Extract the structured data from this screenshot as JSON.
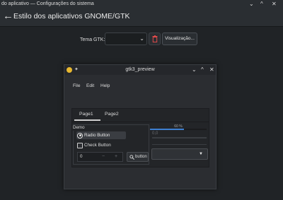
{
  "window": {
    "title": "do aplicativo — Configurações do sistema",
    "controls": {
      "minimize": "⌄",
      "maximize": "^",
      "close": "✕"
    }
  },
  "header": {
    "back_icon": "←",
    "title": "Estilo dos aplicativos GNOME/GTK"
  },
  "gtk_theme": {
    "label": "Tema GTK:",
    "value": "",
    "chevron": "⌄",
    "delete_icon": "trash-icon",
    "delete_color": "#e04a4a",
    "preview_button": "Visualização..."
  },
  "preview_window": {
    "title": "gtk3_preview",
    "controls": {
      "minimize": "⌄",
      "maximize": "^",
      "close": "✕"
    },
    "pin_icon": "✦",
    "menu": [
      "File",
      "Edit",
      "Help"
    ],
    "tabs": [
      "Page1",
      "Page2"
    ],
    "active_tab": 0,
    "demo": {
      "frame_label": "Demo",
      "radio_label": "Radio Button",
      "radio_checked": true,
      "check_label": "Check Button",
      "check_checked": false,
      "spin_value": "0",
      "spin_minus": "−",
      "spin_plus": "+",
      "search_icon": "🔍",
      "search_label": "button"
    },
    "progress": {
      "text": "60 %",
      "fraction": 0.6,
      "color": "#3d7fd1"
    },
    "scale_value": "0,0",
    "dropdown_arrow": "▼"
  }
}
